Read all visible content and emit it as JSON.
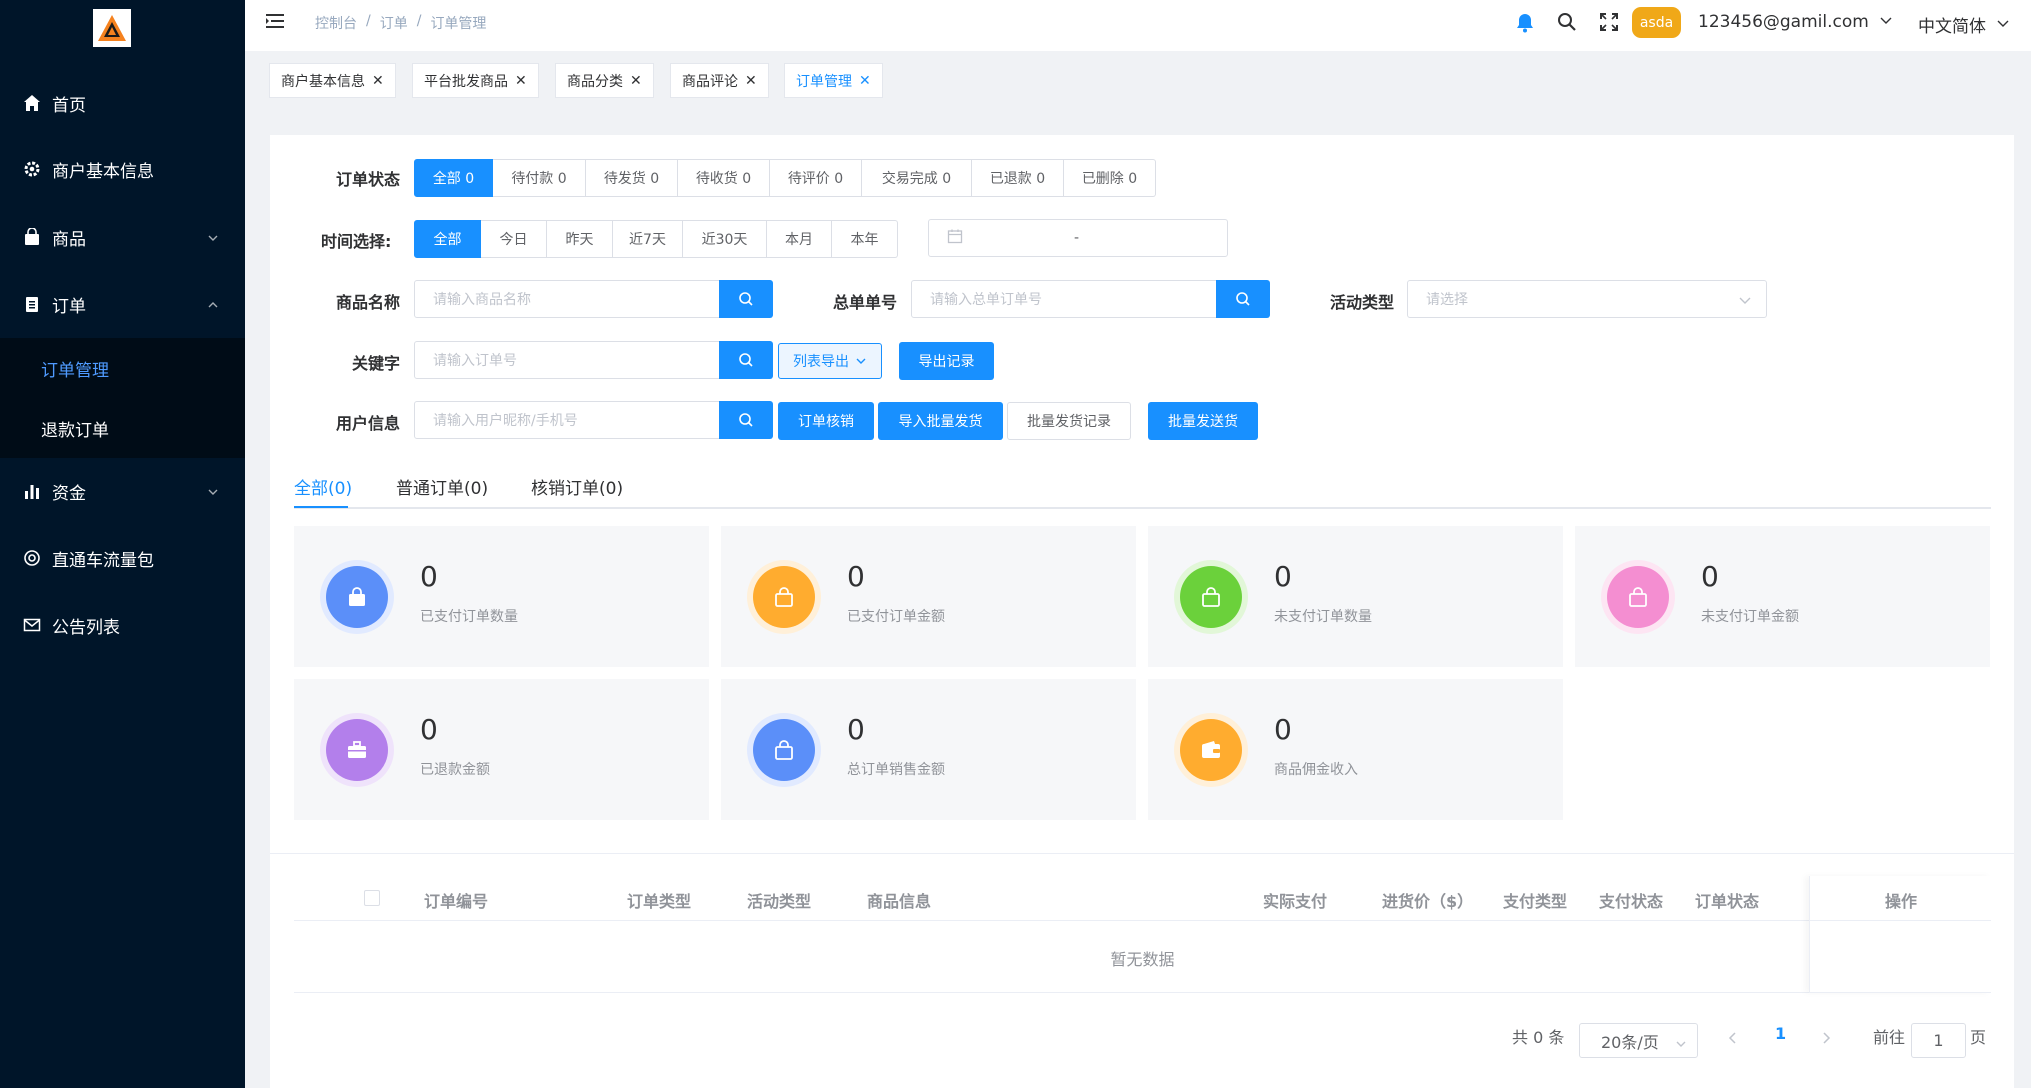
{
  "sidebar": {
    "items": [
      {
        "label": "首页",
        "icon": "home-icon"
      },
      {
        "label": "商户基本信息",
        "icon": "gear-icon"
      },
      {
        "label": "商品",
        "icon": "shopping-bag-icon"
      },
      {
        "label": "订单",
        "icon": "clipboard-icon"
      },
      {
        "label": "资金",
        "icon": "bar-chart-icon"
      },
      {
        "label": "直通车流量包",
        "icon": "lifebuoy-icon"
      },
      {
        "label": "公告列表",
        "icon": "envelope-icon"
      }
    ],
    "submenu": [
      {
        "label": "订单管理",
        "active": true
      },
      {
        "label": "退款订单",
        "active": false
      }
    ]
  },
  "header": {
    "breadcrumb": [
      "控制台",
      "订单",
      "订单管理"
    ],
    "avatar": "asda",
    "email": "123456@gamil.com",
    "language": "中文简体"
  },
  "tags": [
    {
      "label": "商户基本信息",
      "active": false
    },
    {
      "label": "平台批发商品",
      "active": false
    },
    {
      "label": "商品分类",
      "active": false
    },
    {
      "label": "商品评论",
      "active": false
    },
    {
      "label": "订单管理",
      "active": true
    }
  ],
  "filters": {
    "status_label": "订单状态",
    "status_options": [
      "全部 0",
      "待付款 0",
      "待发货 0",
      "待收货 0",
      "待评价 0",
      "交易完成 0",
      "已退款 0",
      "已删除 0"
    ],
    "time_label": "时间选择:",
    "time_options": [
      "全部",
      "今日",
      "昨天",
      "近7天",
      "近30天",
      "本月",
      "本年"
    ],
    "date_separator": "-",
    "product_label": "商品名称",
    "product_placeholder": "请输入商品名称",
    "order_no_label": "总单单号",
    "order_no_placeholder": "请输入总单订单号",
    "activity_label": "活动类型",
    "activity_placeholder": "请选择",
    "keyword_label": "关键字",
    "keyword_placeholder": "请输入订单号",
    "export_list": "列表导出",
    "export_record": "导出记录",
    "user_label": "用户信息",
    "user_placeholder": "请输入用户昵称/手机号",
    "verify_order": "订单核销",
    "import_batch": "导入批量发货",
    "batch_record": "批量发货记录",
    "batch_ship": "批量发送货"
  },
  "tabs": [
    "全部(0)",
    "普通订单(0)",
    "核销订单(0)"
  ],
  "stats": [
    {
      "value": "0",
      "label": "已支付订单数量",
      "color": "#5b8ff9",
      "icon": "bag-icon"
    },
    {
      "value": "0",
      "label": "已支付订单金额",
      "color": "#ffac2f",
      "icon": "bag-icon"
    },
    {
      "value": "0",
      "label": "未支付订单数量",
      "color": "#6bd13b",
      "icon": "bag-icon"
    },
    {
      "value": "0",
      "label": "未支付订单金额",
      "color": "#f48ed1",
      "icon": "bag-icon"
    },
    {
      "value": "0",
      "label": "已退款金额",
      "color": "#b37feb",
      "icon": "briefcase-icon"
    },
    {
      "value": "0",
      "label": "总订单销售金额",
      "color": "#5b8ff9",
      "icon": "bag-icon"
    },
    {
      "value": "0",
      "label": "商品佣金收入",
      "color": "#ffac2f",
      "icon": "wallet-icon"
    }
  ],
  "table": {
    "columns": [
      "订单编号",
      "订单类型",
      "活动类型",
      "商品信息",
      "实际支付",
      "进货价（$）",
      "支付类型",
      "支付状态",
      "订单状态",
      "操作"
    ],
    "empty_text": "暂无数据"
  },
  "pagination": {
    "total": "共 0 条",
    "page_size": "20条/页",
    "current": "1",
    "goto_prefix": "前往",
    "goto_value": "1",
    "goto_suffix": "页"
  }
}
